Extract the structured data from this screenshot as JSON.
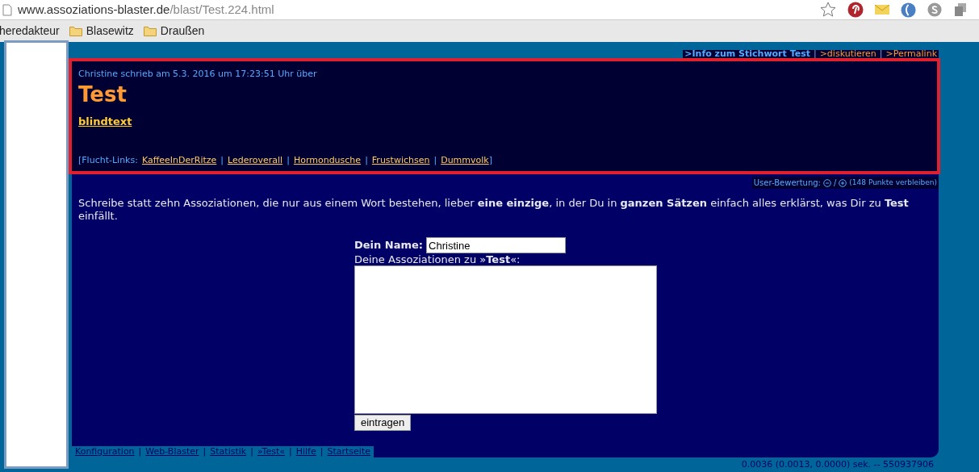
{
  "browser": {
    "url_host": "www.assoziations-blaster.de",
    "url_path": "/blast/Test.224.html",
    "bookmarks": [
      "heredakteur",
      "Blasewitz",
      "Draußen"
    ]
  },
  "top_links": {
    "separator": "|",
    "items": [
      ">Info zum Stichwort **Test**",
      ">diskutieren",
      ">Permalink"
    ]
  },
  "entry": {
    "byline": "Christine schrieb am 5.3. 2016 um 17:23:51 Uhr über",
    "title": "Test",
    "body_link": "blindtext",
    "escape_prefix": "[Flucht-Links:",
    "escape_links": [
      "KaffeeInDerRitze",
      "Lederoverall",
      "Hormondusche",
      "Frustwichsen",
      "Dummvolk"
    ],
    "escape_suffix": "]",
    "separator": "|"
  },
  "rating": {
    "label": "User-Bewertung:",
    "slash": "/",
    "remaining": "(148 Punkte verbleiben)"
  },
  "intro": "Schreibe statt zehn Assoziationen, die nur aus einem Wort bestehen, lieber **eine einzige**, in der Du in **ganzen Sätzen** einfach alles erklärst, was Dir zu **Test** einfällt.",
  "form": {
    "name_label": "Dein Name:",
    "name_value": "Christine",
    "assoc_label": "Deine Assoziationen zu »**Test**«:",
    "submit": "eintragen"
  },
  "footer": {
    "separator": "|",
    "links": [
      "Konfiguration",
      "Web-Blaster",
      "Statistik",
      "»Test«",
      "Hilfe",
      "Startseite"
    ]
  },
  "stats": "0.0036 (0.0013, 0.0000) sek. -- 550937906"
}
